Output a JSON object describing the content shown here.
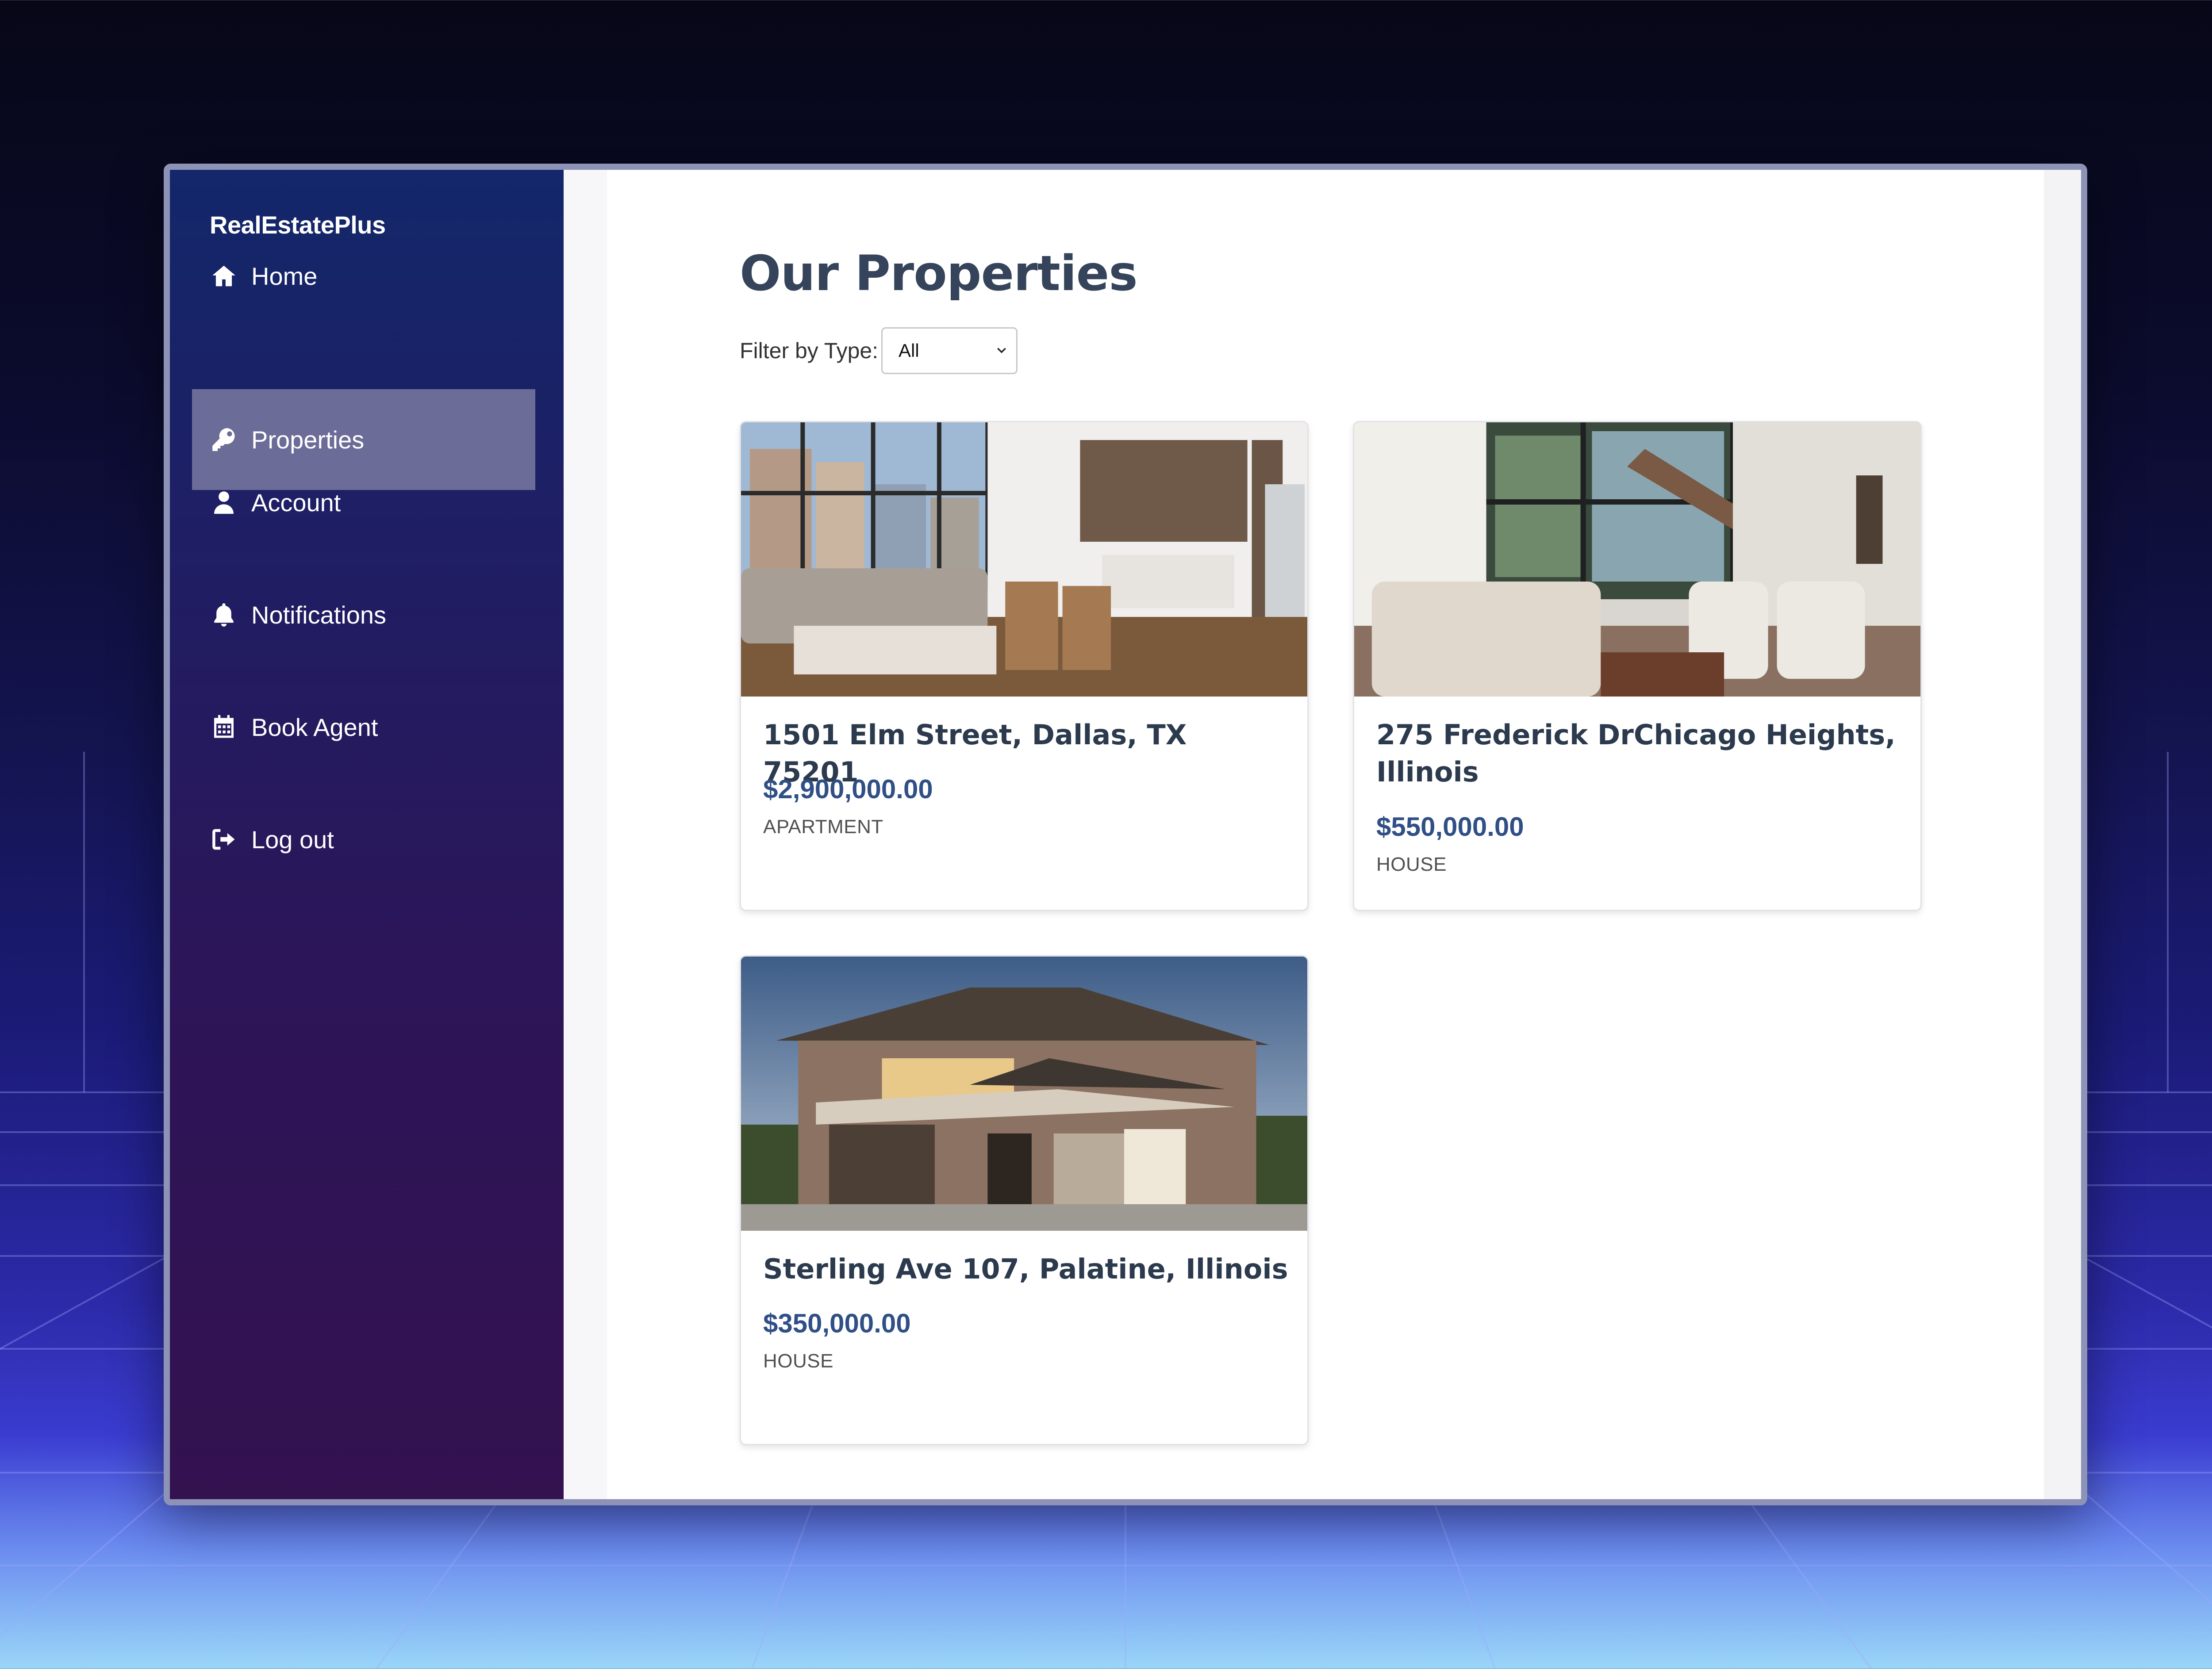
{
  "sidebar": {
    "brand": "RealEstatePlus",
    "items": [
      {
        "label": "Home",
        "icon": "home-icon",
        "active": false
      },
      {
        "label": "Properties",
        "icon": "key-icon",
        "active": true
      },
      {
        "label": "Account",
        "icon": "user-icon",
        "active": false
      },
      {
        "label": "Notifications",
        "icon": "bell-icon",
        "active": false
      },
      {
        "label": "Book Agent",
        "icon": "calendar-icon",
        "active": false
      },
      {
        "label": "Log out",
        "icon": "logout-icon",
        "active": false
      }
    ]
  },
  "main": {
    "title": "Our Properties",
    "filter": {
      "label": "Filter by Type:",
      "selected": "All"
    },
    "properties": [
      {
        "address": "1501 Elm Street, Dallas, TX 75201",
        "price": "$2,900,000.00",
        "type": "APARTMENT",
        "image": "apartment-interior-photo"
      },
      {
        "address": "275 Frederick DrChicago Heights, Illinois",
        "price": "$550,000.00",
        "type": "HOUSE",
        "image": "house-interior-photo"
      },
      {
        "address": "Sterling Ave 107, Palatine, Illinois",
        "price": "$350,000.00",
        "type": "HOUSE",
        "image": "house-exterior-photo"
      }
    ]
  },
  "colors": {
    "sidebar_top": "#13276a",
    "sidebar_bottom": "#34114f",
    "active_item": "#6c6c98",
    "title": "#35445a",
    "price": "#2f4f86"
  }
}
